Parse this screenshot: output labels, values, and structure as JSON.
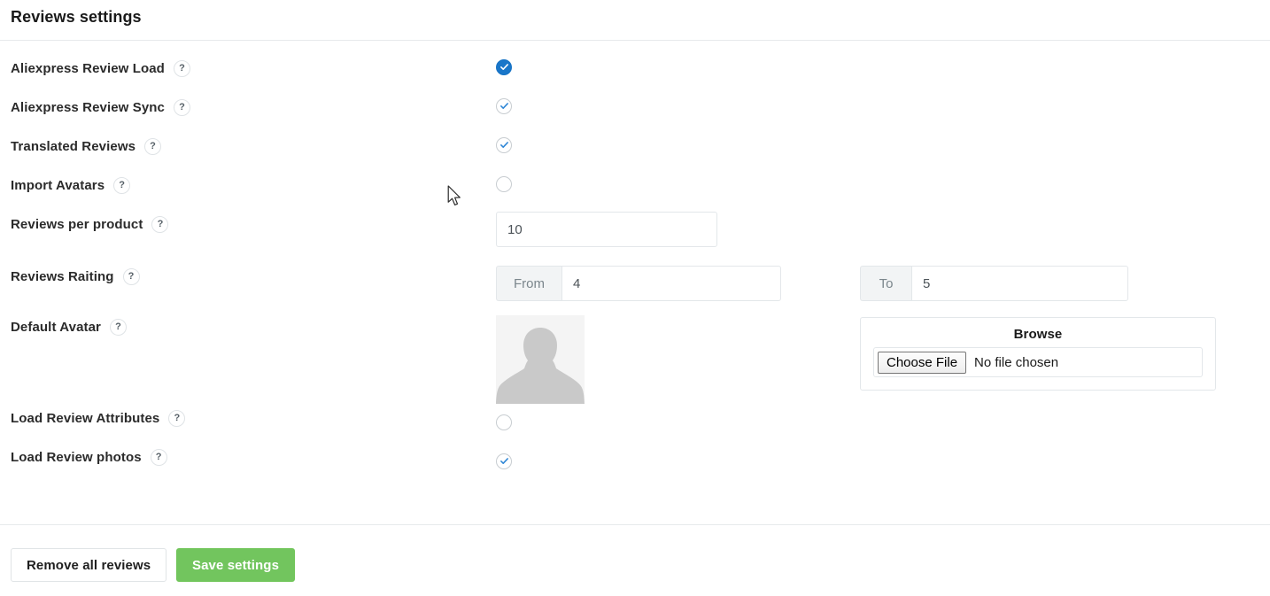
{
  "header": {
    "title": "Reviews settings"
  },
  "help_icon_label": "?",
  "rows": [
    {
      "label": "Aliexpress Review Load",
      "control": "checkbox",
      "state": "checked-focused",
      "help": "?"
    },
    {
      "label": "Aliexpress Review Sync",
      "control": "checkbox",
      "state": "checked",
      "help": "?"
    },
    {
      "label": "Translated Reviews",
      "control": "checkbox",
      "state": "checked",
      "help": "?"
    },
    {
      "label": "Import Avatars",
      "control": "checkbox",
      "state": "unchecked",
      "help": "?"
    },
    {
      "label": "Reviews per product",
      "control": "text",
      "value": "10",
      "help": "?"
    },
    {
      "label": "Reviews Raiting",
      "control": "range",
      "help": "?",
      "from_addon": "From",
      "from_value": "4",
      "to_addon": "To",
      "to_value": "5"
    },
    {
      "label": "Default Avatar",
      "control": "file",
      "help": "?",
      "browse_caption": "Browse",
      "choose_file_label": "Choose File",
      "file_status": "No file chosen"
    },
    {
      "label": "Load Review Attributes",
      "control": "checkbox",
      "state": "unchecked",
      "help": "?"
    },
    {
      "label": "Load Review photos",
      "control": "checkbox",
      "state": "checked",
      "help": "?"
    }
  ],
  "footer": {
    "remove_label": "Remove all reviews",
    "save_label": "Save settings"
  },
  "colors": {
    "accent_checkbox": "#1976c9",
    "save_button": "#72c55e",
    "border": "#e3e7ea",
    "avatar_bg": "#f4f4f4"
  }
}
